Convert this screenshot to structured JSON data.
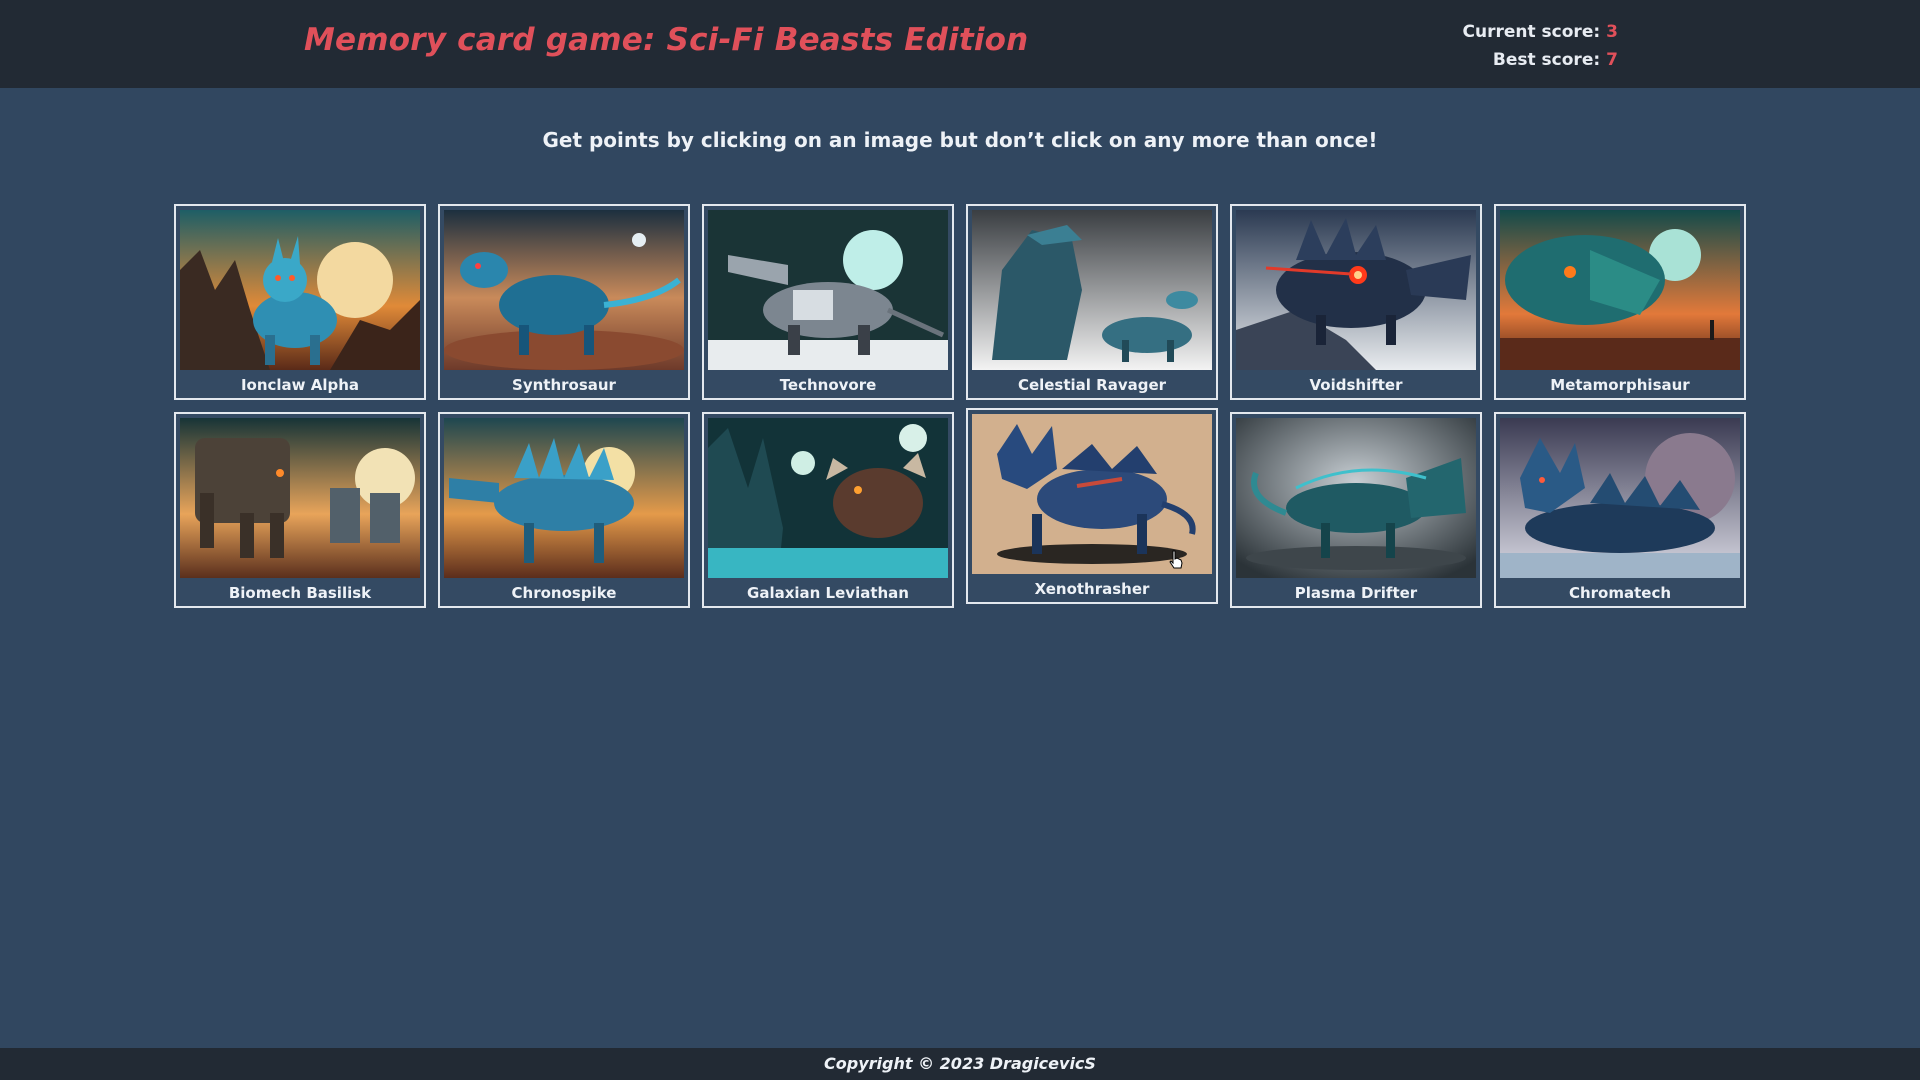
{
  "header": {
    "title": "Memory card game: Sci-Fi Beasts Edition",
    "current_score_label": "Current score:",
    "current_score": "3",
    "best_score_label": "Best score:",
    "best_score": "7"
  },
  "instructions": "Get points by clicking on an image but don’t click on any more than once!",
  "cards": [
    {
      "label": "Ionclaw Alpha"
    },
    {
      "label": "Synthrosaur"
    },
    {
      "label": "Technovore"
    },
    {
      "label": "Celestial Ravager"
    },
    {
      "label": "Voidshifter"
    },
    {
      "label": "Metamorphisaur"
    },
    {
      "label": "Biomech Basilisk"
    },
    {
      "label": "Chronospike"
    },
    {
      "label": "Galaxian Leviathan"
    },
    {
      "label": "Xenothrasher"
    },
    {
      "label": "Plasma Drifter"
    },
    {
      "label": "Chromatech"
    }
  ],
  "footer": "Copyright © 2023 DragicevicS",
  "colors": {
    "accent": "#e0505a",
    "background": "#314760",
    "bar": "#222a34"
  }
}
